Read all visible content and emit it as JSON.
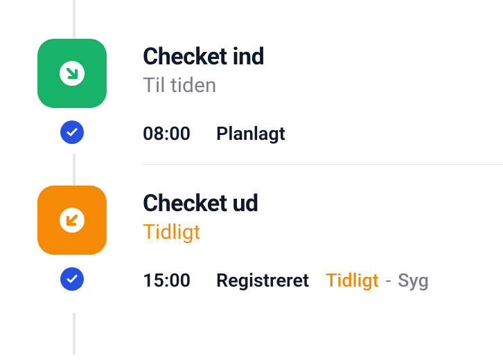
{
  "timeline": {
    "items": [
      {
        "title": "Checket ind",
        "subtitle": "Til tiden",
        "subtitle_color": "grey",
        "badge_color": "green",
        "time": "08:00",
        "status_label": "Planlagt",
        "tag1": "",
        "sep": "",
        "tag2": ""
      },
      {
        "title": "Checket ud",
        "subtitle": "Tidligt",
        "subtitle_color": "orange",
        "badge_color": "orange",
        "time": "15:00",
        "status_label": "Registreret",
        "tag1": "Tidligt",
        "sep": "-",
        "tag2": "Syg"
      }
    ]
  },
  "colors": {
    "green": "#18b268",
    "orange": "#f58a07",
    "blue": "#2451e0",
    "line": "#e5e7eb"
  }
}
